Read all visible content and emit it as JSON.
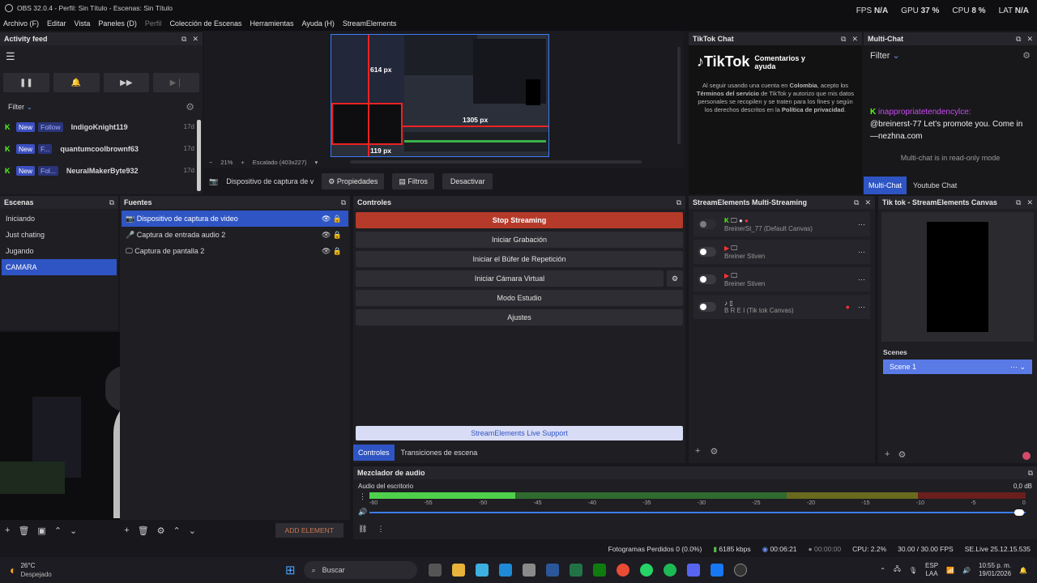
{
  "window": {
    "title": "OBS 32.0.4 - Perfil: Sin Título - Escenas: Sin Título"
  },
  "menu": [
    "Archivo (F)",
    "Editar",
    "Vista",
    "Paneles (D)",
    "Perfil",
    "Colección de Escenas",
    "Herramientas",
    "Ayuda (H)",
    "StreamElements"
  ],
  "stats": {
    "fps_label": "FPS",
    "fps": "N/A",
    "gpu_label": "GPU",
    "gpu": "37 %",
    "cpu_label": "CPU",
    "cpu": "8 %",
    "lat_label": "LAT",
    "lat": "N/A"
  },
  "activity": {
    "title": "Activity feed",
    "filter": "Filter",
    "rows": [
      {
        "badge": "New",
        "action": "Follow",
        "user": "IndigoKnight119",
        "time": "17d"
      },
      {
        "badge": "New",
        "action": "F...",
        "user": "quantumcoolbrownf63",
        "time": "17d"
      },
      {
        "badge": "New",
        "action": "Fol...",
        "user": "NeuralMakerByte932",
        "time": "17d"
      }
    ]
  },
  "preview": {
    "zoom": "21%",
    "scale_label": "Escalado (403x227)",
    "measure_top": "614 px",
    "measure_right": "1305 px",
    "measure_bottom": "119 px"
  },
  "source_toolbar": {
    "source": "Dispositivo de captura de v",
    "props": "Propiedades",
    "filters": "Filtros",
    "deactivate": "Desactivar"
  },
  "tiktok": {
    "title": "TikTok Chat",
    "brand": "TikTok",
    "heading": "Comentarios y ayuda",
    "text1": "Al seguir usando una cuenta en",
    "country": "Colombia",
    "text2": ", acepto los",
    "terms": "Términos del servicio",
    "text3": " de TikTok y autorizo que mis datos personales se recopilen y se traten para los fines y según los derechos descritos en la ",
    "privacy": "Política de privacidad",
    "text4": "."
  },
  "multichat": {
    "title": "Multi-Chat",
    "filter": "Filter",
    "user": "inappropriatetendencylce:",
    "message": "@breinerst-77 Let's promote you. Come in —nezhna.com",
    "readonly": "Multi-chat is in read-only mode",
    "tab1": "Multi-Chat",
    "tab2": "Youtube Chat"
  },
  "scenes": {
    "title": "Escenas",
    "items": [
      "Iniciando",
      "Just chating",
      "Jugando",
      "CAMARA"
    ]
  },
  "sources": {
    "title": "Fuentes",
    "items": [
      "Dispositivo de captura de video",
      "Captura de entrada audio 2",
      "Captura de pantalla 2"
    ],
    "add_element": "ADD ELEMENT"
  },
  "controls": {
    "title": "Controles",
    "stop": "Stop Streaming",
    "record": "Iniciar Grabación",
    "replay": "Iniciar el Búfer de Repetición",
    "vcam": "Iniciar Cámara Virtual",
    "studio": "Modo Estudio",
    "settings": "Ajustes",
    "support": "StreamElements Live Support",
    "tab1": "Controles",
    "tab2": "Transiciones de escena"
  },
  "multistream": {
    "title": "StreamElements Multi-Streaming",
    "rows": [
      {
        "name": "BreinerSt_77 (Default Canvas)"
      },
      {
        "name": "Breiner Stiven"
      },
      {
        "name": "Breiner Stiven"
      },
      {
        "name": "B R E I  (Tik tok Canvas)"
      }
    ]
  },
  "canvas": {
    "title": "Tik tok - StreamElements Canvas",
    "scenes_label": "Scenes",
    "scene": "Scene 1"
  },
  "mixer": {
    "title": "Mezclador de audio",
    "track": "Audio del escritorio",
    "db": "0,0 dB",
    "ticks": [
      "-60",
      "-55",
      "-50",
      "-45",
      "-40",
      "-35",
      "-30",
      "-25",
      "-20",
      "-15",
      "-10",
      "-5",
      "0"
    ],
    "level": 0.35
  },
  "statusbar": {
    "dropped": "Fotogramas Perdidos 0 (0.0%)",
    "bitrate": "6185 kbps",
    "live_time": "00:06:21",
    "rec_time": "00:00:00",
    "cpu": "CPU: 2.2%",
    "fps": "30.00 / 30.00 FPS",
    "version": "SE.Live 25.12.15.535"
  },
  "taskbar": {
    "temp": "26°C",
    "weather": "Despejado",
    "search": "Buscar",
    "lang1": "ESP",
    "lang2": "LAA",
    "time": "10:55 p. m.",
    "date": "19/01/2026"
  }
}
